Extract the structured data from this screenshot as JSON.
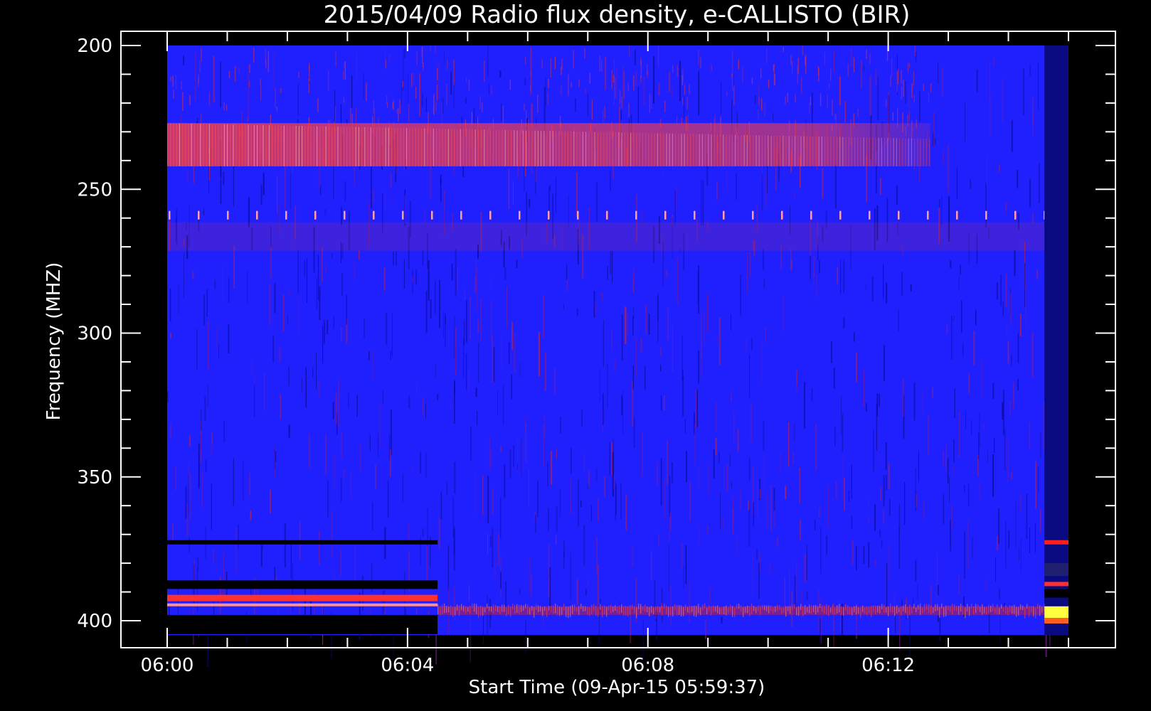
{
  "chart_data": {
    "type": "heatmap",
    "title": "2015/04/09  Radio flux density, e-CALLISTO (BIR)",
    "xlabel": "Start Time (09-Apr-15 05:59:37)",
    "ylabel": "Frequency (MHZ)",
    "x_unit": "UT time",
    "x_range": [
      "06:00",
      "06:15"
    ],
    "y_range": [
      200,
      405
    ],
    "y_inverted": true,
    "x_ticks": [
      {
        "label": "06:00",
        "minutes": 0
      },
      {
        "label": "06:04",
        "minutes": 4
      },
      {
        "label": "06:08",
        "minutes": 8
      },
      {
        "label": "06:12",
        "minutes": 12
      }
    ],
    "y_ticks": [
      200,
      250,
      300,
      350,
      400
    ],
    "colormap": {
      "low": "#000000",
      "mid": "#2020ff",
      "high": "#ff2020",
      "peak": "#ffff40"
    },
    "background_color": "#000000",
    "features": {
      "band_230_242_MHz": {
        "f_start": 227,
        "f_end": 242,
        "t_end_min": 12.7
      },
      "periodic_spikes": {
        "freq": 259
      },
      "interference_top": {
        "f_start": 205,
        "f_end": 225
      },
      "gap_early": {
        "t_end_min": 4.5
      },
      "dropout_late": {
        "t_start_min": 14.6
      }
    }
  }
}
